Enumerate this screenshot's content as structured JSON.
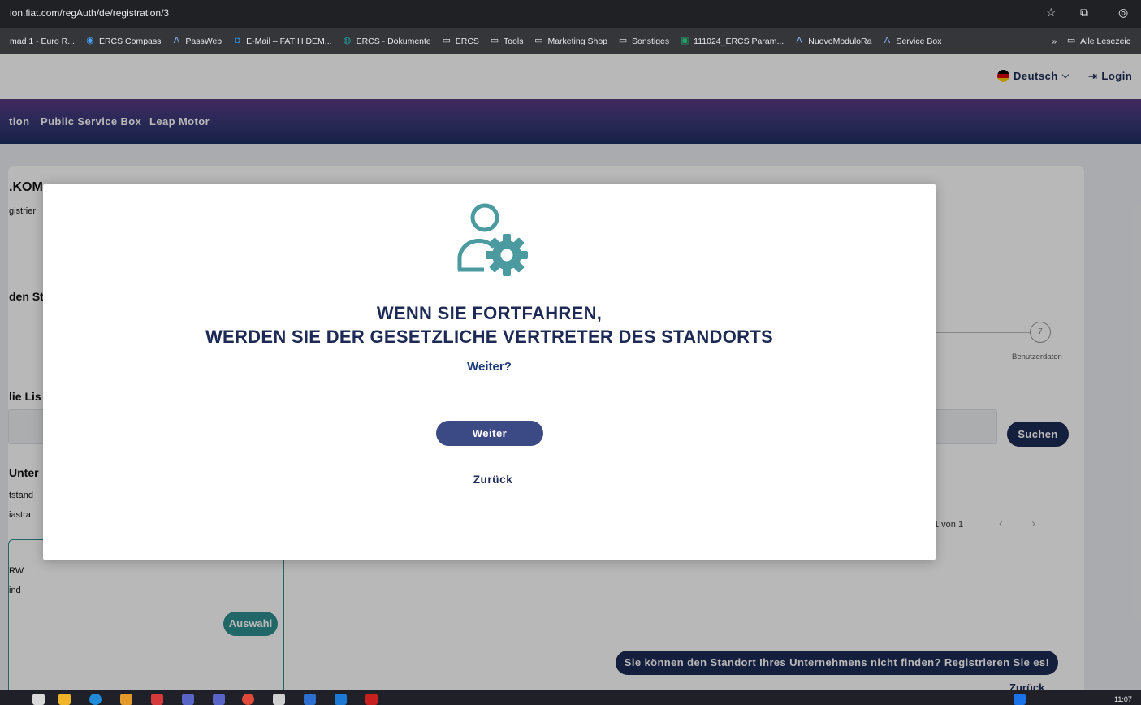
{
  "browser": {
    "url": "ion.fiat.com/regAuth/de/registration/3",
    "bookmarks": [
      {
        "label": "mad 1 - Euro R...",
        "icon": "none"
      },
      {
        "label": "ERCS Compass",
        "icon": "compass-icon"
      },
      {
        "label": "PassWeb",
        "icon": "caret-logo-icon"
      },
      {
        "label": "E-Mail – FATIH DEM...",
        "icon": "outlook-icon"
      },
      {
        "label": "ERCS - Dokumente",
        "icon": "sharepoint-icon"
      },
      {
        "label": "ERCS",
        "icon": "folder-icon"
      },
      {
        "label": "Tools",
        "icon": "folder-icon"
      },
      {
        "label": "Marketing Shop",
        "icon": "folder-icon"
      },
      {
        "label": "Sonstiges",
        "icon": "folder-icon"
      },
      {
        "label": "111024_ERCS Param...",
        "icon": "excel-icon"
      },
      {
        "label": "NuovoModuloRa",
        "icon": "caret-logo-icon"
      },
      {
        "label": "Service Box",
        "icon": "caret-logo-icon"
      }
    ],
    "more_label": "»",
    "all_bookmarks": "Alle Lesezeic"
  },
  "header": {
    "language": "Deutsch",
    "login": "Login"
  },
  "nav": {
    "items": [
      "tion",
      "Public Service Box",
      "Leap Motor"
    ]
  },
  "background": {
    "title_fragment": ".KOM",
    "subtitle_fragment": "gistrier",
    "section1_fragment": "den St",
    "section2_fragment": "lie Lis",
    "company_fragment": "Unter",
    "line1_fragment": "tstand",
    "line2_fragment": "iastra",
    "line3_fragment": "RW",
    "line4_fragment": "ind",
    "step_number": "7",
    "step_label": "Benutzerdaten",
    "search_button": "Suchen",
    "pager_text": "1 von 1",
    "select_button": "Auswahl",
    "register_button": "Sie können den Standort Ihres Unternehmens nicht finden? Registrieren Sie es!",
    "back_link": "Zurück"
  },
  "modal": {
    "title_line1": "WENN SIE FORTFAHREN,",
    "title_line2": "WERDEN SIE DER GESETZLICHE VERTRETER DES STANDORTS",
    "question": "Weiter?",
    "continue_button": "Weiter",
    "back_link": "Zurück"
  },
  "taskbar": {
    "time": "11:07"
  },
  "colors": {
    "brand_navy": "#1d2a55",
    "teal": "#2f8f8f",
    "icon_teal": "#4a9aa0"
  }
}
